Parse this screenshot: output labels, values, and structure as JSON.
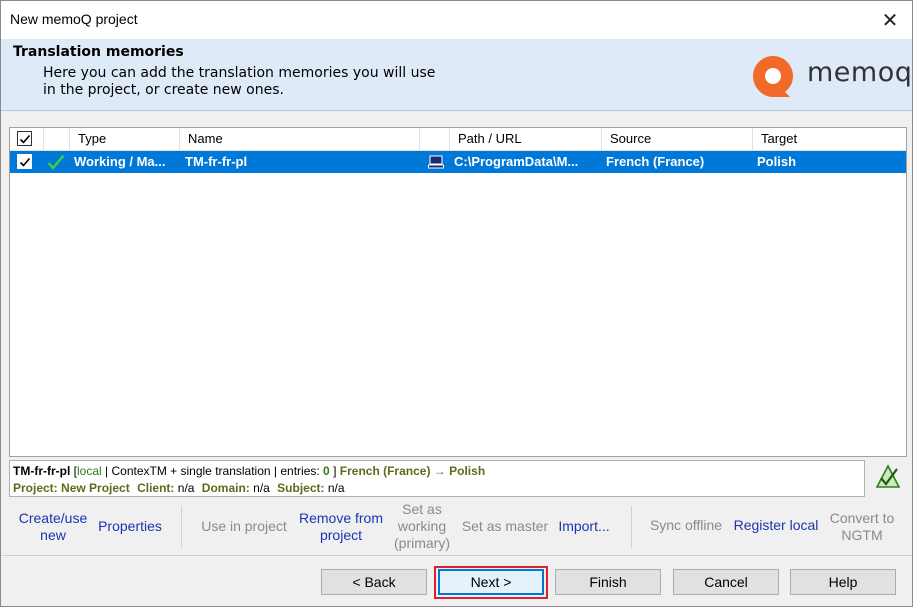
{
  "window": {
    "title": "New memoQ project"
  },
  "header": {
    "title": "Translation memories",
    "description_line1": "Here you can add the translation memories you will use",
    "description_line2": "in the project, or create new ones.",
    "logo_text": "memoq"
  },
  "table": {
    "columns": [
      "Type",
      "Name",
      "",
      "Path / URL",
      "Source",
      "Target"
    ],
    "rows": [
      {
        "checked": true,
        "type": "Working / Ma...",
        "name": "TM-fr-fr-pl",
        "path": "C:\\ProgramData\\M...",
        "source": "French (France)",
        "target": "Polish",
        "selected": true
      }
    ]
  },
  "info": {
    "name": "TM-fr-fr-pl",
    "open_bracket": "[",
    "location": "local",
    "details": "| ContexTM + single translation | entries:",
    "entries": "0",
    "close_bracket": "]",
    "source": "French (France)",
    "arrow": "→",
    "target": "Polish",
    "project_label": "Project:",
    "project_value": "New Project",
    "client_label": "Client:",
    "client_value": "n/a",
    "domain_label": "Domain:",
    "domain_value": "n/a",
    "subject_label": "Subject:",
    "subject_value": "n/a"
  },
  "actions": {
    "create_line1": "Create/use",
    "create_line2": "new",
    "properties": "Properties",
    "use_in_project": "Use in project",
    "remove_line1": "Remove from",
    "remove_line2": "project",
    "set_working_line1": "Set as",
    "set_working_line2": "working",
    "set_working_line3": "(primary)",
    "set_master": "Set as master",
    "import": "Import...",
    "sync_offline": "Sync offline",
    "register_local": "Register local",
    "convert_line1": "Convert to",
    "convert_line2": "NGTM"
  },
  "buttons": {
    "back": "< Back",
    "next": "Next >",
    "finish": "Finish",
    "cancel": "Cancel",
    "help": "Help"
  },
  "colors": {
    "selection": "#0078d7",
    "link": "#1b35b0",
    "highlight_outline": "#e0212f",
    "logo_orange": "#f26a2a"
  }
}
